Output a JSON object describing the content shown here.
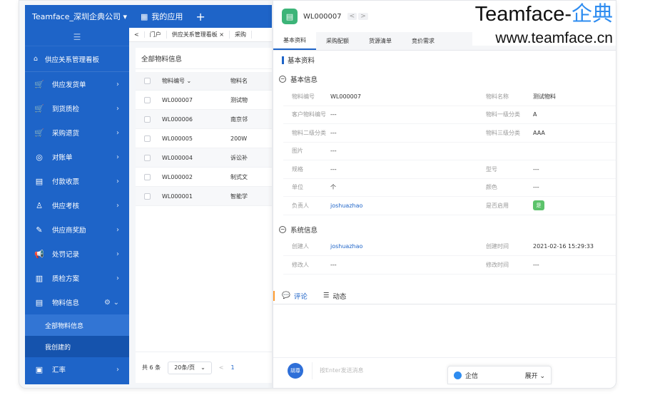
{
  "topbar": {
    "company": "Teamface_深圳企典公司 ▾",
    "apps_label": "我的应用",
    "plus": "+"
  },
  "sidebar": {
    "toggle": "☰",
    "board": "供应关系管理看板",
    "items": [
      {
        "label": "供应发货单",
        "icon": "cart-icon",
        "glyph": "🛒"
      },
      {
        "label": "到货质检",
        "icon": "cart-icon",
        "glyph": "🛒"
      },
      {
        "label": "采购退货",
        "icon": "cart-icon",
        "glyph": "🛒"
      },
      {
        "label": "对账单",
        "icon": "target-icon",
        "glyph": "◎"
      },
      {
        "label": "付款收票",
        "icon": "document-icon",
        "glyph": "▤"
      },
      {
        "label": "供应考核",
        "icon": "users-icon",
        "glyph": "♙"
      },
      {
        "label": "供应商奖励",
        "icon": "edit-icon",
        "glyph": "✎"
      },
      {
        "label": "处罚记录",
        "icon": "megaphone-icon",
        "glyph": "📢"
      },
      {
        "label": "质检方案",
        "icon": "book-icon",
        "glyph": "▥"
      },
      {
        "label": "物料信息",
        "icon": "material-icon",
        "glyph": "▤"
      }
    ],
    "sub_items": [
      "全部物料信息",
      "我创建的"
    ],
    "last_item": {
      "label": "汇率",
      "glyph": "▣"
    }
  },
  "tabs": [
    "<",
    "门户",
    "供应关系管理看板 ×",
    "采购"
  ],
  "list": {
    "title": "全部物料信息",
    "headers": [
      "物料编号 ⌄",
      "物料名"
    ],
    "rows": [
      {
        "code": "WL000007",
        "name": "测试物"
      },
      {
        "code": "WL000006",
        "name": "南京邻"
      },
      {
        "code": "WL000005",
        "name": "200W"
      },
      {
        "code": "WL000004",
        "name": "诉讼补"
      },
      {
        "code": "WL000002",
        "name": "制式文"
      },
      {
        "code": "WL000001",
        "name": "智能学"
      }
    ],
    "footer": {
      "total": "共 6 条",
      "page_size": "20条/页",
      "page_prev": "<",
      "page_num": "1"
    }
  },
  "detail": {
    "code": "WL000007",
    "nav_prev": "<",
    "nav_next": ">",
    "tabs": [
      "基本资料",
      "采购配额",
      "货源清单",
      "竞价需求"
    ],
    "section": "基本资料",
    "group_basic": "基本信息",
    "fields": [
      {
        "l1": "物料编号",
        "v1": "WL000007",
        "l2": "物料名称",
        "v2": "测试物料"
      },
      {
        "l1": "客户物料编号",
        "v1": "---",
        "l2": "物料一级分类",
        "v2": "A"
      },
      {
        "l1": "物料二级分类",
        "v1": "---",
        "l2": "物料三级分类",
        "v2": "AAA"
      },
      {
        "l1": "图片",
        "v1": "---",
        "l2": "",
        "v2": ""
      },
      {
        "l1": "规格",
        "v1": "---",
        "l2": "型号",
        "v2": "---"
      },
      {
        "l1": "单位",
        "v1": "个",
        "l2": "颜色",
        "v2": "---"
      }
    ],
    "owner": {
      "label": "负责人",
      "value": "joshuazhao",
      "enabled_label": "是否启用",
      "enabled_value": "是"
    },
    "group_system": "系统信息",
    "sys_fields": [
      {
        "l1": "创建人",
        "v1": "joshuazhao",
        "l2": "创建时间",
        "v2": "2021-02-16 15:29:33"
      },
      {
        "l1": "修改人",
        "v1": "---",
        "l2": "修改时间",
        "v2": "---"
      }
    ],
    "comment_tab": "评论",
    "activity_tab": "动态",
    "avatar": "胡尊",
    "message_placeholder": "按Enter发送消息"
  },
  "qixin": {
    "label": "企信",
    "expand": "展开"
  },
  "watermark": {
    "brand": "Teamface-",
    "brand_cn": "企典",
    "url": "www.teamface.cn"
  },
  "colors": {
    "primary": "#1e64c8",
    "accent_orange": "#ff9b2e",
    "enabled_green": "#5cc36b"
  }
}
